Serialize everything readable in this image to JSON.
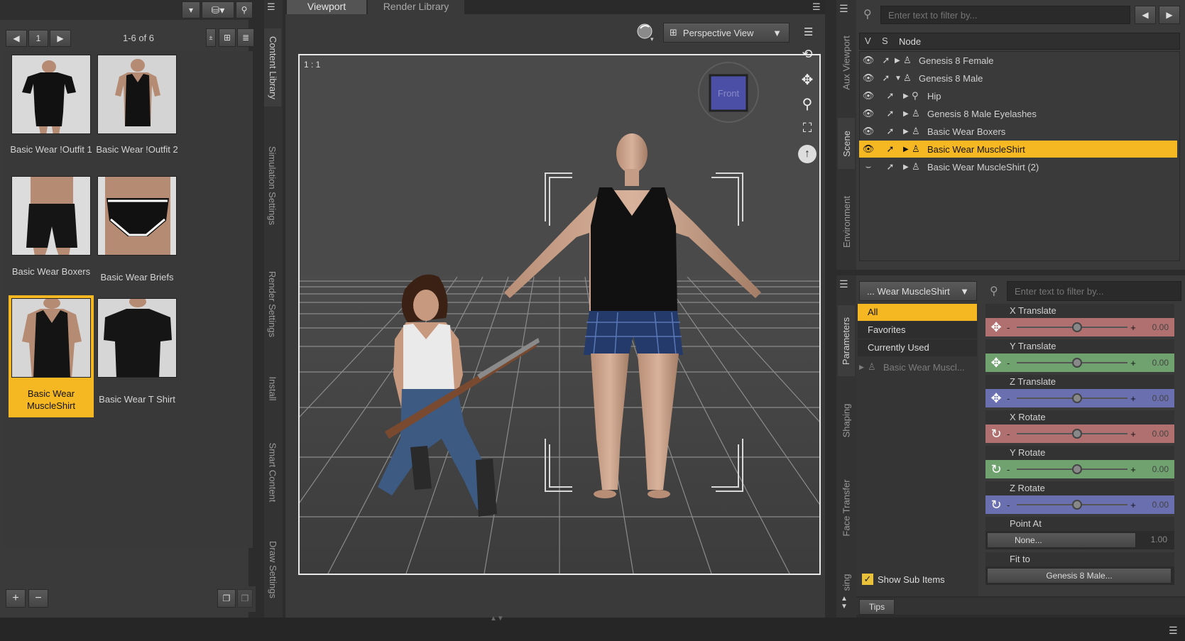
{
  "colors": {
    "accent": "#f5b823",
    "x_axis": "#b07070",
    "y_axis": "#6fa26f",
    "z_axis": "#6a6fb0"
  },
  "content_library": {
    "page_number": "1",
    "page_info": "1-6 of 6",
    "items": [
      {
        "label": "Basic Wear !Outfit 1",
        "selected": false
      },
      {
        "label": "Basic Wear !Outfit 2",
        "selected": false
      },
      {
        "label": "Basic Wear Boxers",
        "selected": false
      },
      {
        "label": "Basic Wear Briefs",
        "selected": false
      },
      {
        "label": "Basic Wear MuscleShirt",
        "selected": true
      },
      {
        "label": "Basic Wear T Shirt",
        "selected": false
      }
    ]
  },
  "left_tabs": [
    "Content Library",
    "Simulation Settings",
    "Render Settings",
    "Install",
    "Smart Content",
    "Draw Settings"
  ],
  "viewport": {
    "tabs": [
      "Viewport",
      "Render Library"
    ],
    "view_label": "Perspective View",
    "aspect_label": "1 : 1",
    "cube_label": "Front"
  },
  "right_tabs_top": [
    "Aux Viewport",
    "Scene",
    "Environment"
  ],
  "right_tabs_bottom": [
    "Parameters",
    "Shaping",
    "Face Transfer",
    "sing"
  ],
  "scene": {
    "filter_placeholder": "Enter text to filter by...",
    "col_v": "V",
    "col_s": "S",
    "col_node": "Node",
    "nodes": [
      {
        "label": "Genesis 8 Female",
        "depth": 0,
        "selected": false,
        "icon": "figure-icon"
      },
      {
        "label": "Genesis 8 Male",
        "depth": 0,
        "selected": false,
        "icon": "figure-icon"
      },
      {
        "label": "Hip",
        "depth": 1,
        "selected": false,
        "icon": "bone-icon"
      },
      {
        "label": "Genesis 8 Male Eyelashes",
        "depth": 1,
        "selected": false,
        "icon": "figure-icon"
      },
      {
        "label": "Basic Wear Boxers",
        "depth": 1,
        "selected": false,
        "icon": "figure-icon"
      },
      {
        "label": "Basic Wear MuscleShirt",
        "depth": 1,
        "selected": true,
        "icon": "figure-icon"
      },
      {
        "label": "Basic Wear MuscleShirt (2)",
        "depth": 1,
        "selected": false,
        "icon": "figure-icon"
      }
    ]
  },
  "parameters": {
    "node_selector": "... Wear MuscleShirt",
    "filter_placeholder": "Enter text to filter by...",
    "categories": [
      "All",
      "Favorites",
      "Currently Used"
    ],
    "tree_item": "Basic Wear Muscl...",
    "show_sub_items": "Show Sub Items",
    "sliders": [
      {
        "label": "X Translate",
        "value": "0.00",
        "axis": "x",
        "kind": "translate"
      },
      {
        "label": "Y Translate",
        "value": "0.00",
        "axis": "y",
        "kind": "translate"
      },
      {
        "label": "Z Translate",
        "value": "0.00",
        "axis": "z",
        "kind": "translate"
      },
      {
        "label": "X Rotate",
        "value": "0.00",
        "axis": "x",
        "kind": "rotate"
      },
      {
        "label": "Y Rotate",
        "value": "0.00",
        "axis": "y",
        "kind": "rotate"
      },
      {
        "label": "Z Rotate",
        "value": "0.00",
        "axis": "z",
        "kind": "rotate"
      }
    ],
    "point_at": {
      "label": "Point At",
      "value": "None...",
      "number": "1.00"
    },
    "fit_to": {
      "label": "Fit to",
      "value": "Genesis 8 Male..."
    }
  },
  "tips_label": "Tips"
}
